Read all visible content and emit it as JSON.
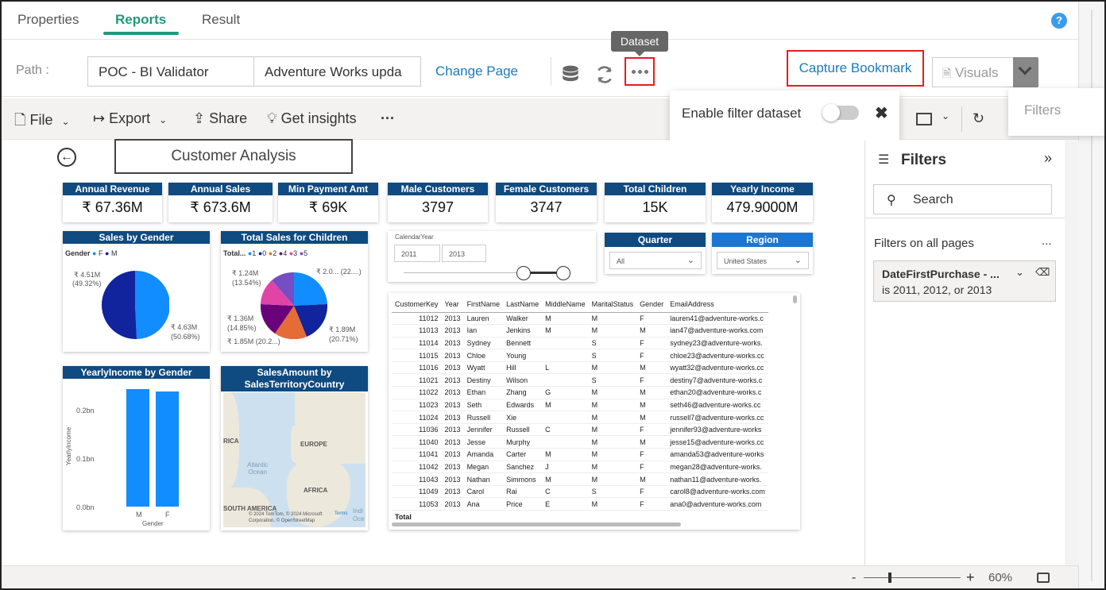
{
  "tabs": [
    {
      "label": "Properties"
    },
    {
      "label": "Reports"
    },
    {
      "label": "Result"
    }
  ],
  "help_label": "?",
  "path": {
    "label": "Path :",
    "workspace": "POC - BI Validator",
    "report": "Adventure Works upda",
    "change_page": "Change Page",
    "tooltip": "Dataset",
    "capture_bookmark": "Capture Bookmark",
    "visuals": "Visuals",
    "filters_tab": "Filters"
  },
  "toolbar": {
    "file": "File",
    "export": "Export",
    "share": "Share",
    "insights": "Get insights",
    "more": "···"
  },
  "popup": {
    "label": "Enable filter dataset",
    "close": "✖",
    "enabled": false
  },
  "report": {
    "title": "Customer Analysis",
    "cards": [
      {
        "title": "Annual Revenue",
        "value": "₹ 67.36M"
      },
      {
        "title": "Annual Sales",
        "value": "₹ 673.6M"
      },
      {
        "title": "Min Payment Amt",
        "value": "₹ 69K"
      },
      {
        "title": "Male Customers",
        "value": "3797"
      },
      {
        "title": "Female Customers",
        "value": "3747"
      },
      {
        "title": "Total Children",
        "value": "15K"
      },
      {
        "title": "Yearly Income",
        "value": "479.9000M"
      }
    ],
    "sales_by_gender": {
      "title": "Sales by Gender",
      "legend_title": "Gender",
      "legend": [
        "F",
        "M"
      ],
      "label_m": "₹ 4.51M",
      "label_m_pct": "(49.32%)",
      "label_f": "₹ 4.63M",
      "label_f_pct": "(50.68%)"
    },
    "sales_children": {
      "title": "Total Sales for Children",
      "legend_title": "Total...",
      "legend": [
        "1",
        "0",
        "2",
        "4",
        "3",
        "5"
      ],
      "lbl1": "₹ 1.24M",
      "lbl1p": "(13.54%)",
      "lbl2": "₹ 2.0... (22....)",
      "lbl3": "₹ 1.36M",
      "lbl3p": "(14.85%)",
      "lbl4": "₹ 1.89M",
      "lbl4p": "(20.71%)",
      "lbl5": "₹ 1.85M (20.2...)"
    },
    "calendar": {
      "title": "CalendarYear",
      "from": "2011",
      "to": "2013"
    },
    "quarter": {
      "title": "Quarter",
      "value": "All"
    },
    "region": {
      "title": "Region",
      "value": "United States"
    },
    "yearly_income": {
      "title": "YearlyIncome by Gender",
      "ylabel": "YearlyIncome",
      "xlabel": "Gender",
      "ticks": [
        "0.2bn",
        "0.1bn",
        "0.0bn"
      ]
    },
    "map": {
      "title": "SalesAmount by SalesTerritoryCountry",
      "labels": {
        "rica": "RICA",
        "europe": "EUROPE",
        "ocean": "Atlantic\nOcean",
        "africa": "AFRICA",
        "sa": "SOUTH AMERICA",
        "indi": "Indi",
        "oce": "Oce"
      },
      "credit": "© 2024 TomTom, © 2024 Microsoft Corporation, © OpenStreetMap",
      "terms": "Terms"
    },
    "table": {
      "headers": [
        "CustomerKey",
        "Year",
        "FirstName",
        "LastName",
        "MiddleName",
        "MaritalStatus",
        "Gender",
        "EmailAddress"
      ],
      "rows": [
        [
          "11012",
          "2013",
          "Lauren",
          "Walker",
          "M",
          "M",
          "F",
          "lauren41@adventure-works.c"
        ],
        [
          "11013",
          "2013",
          "Ian",
          "Jenkins",
          "M",
          "M",
          "M",
          "ian47@adventure-works.com"
        ],
        [
          "11014",
          "2013",
          "Sydney",
          "Bennett",
          "",
          "S",
          "F",
          "sydney23@adventure-works."
        ],
        [
          "11015",
          "2013",
          "Chloe",
          "Young",
          "",
          "S",
          "F",
          "chloe23@adventure-works.cc"
        ],
        [
          "11016",
          "2013",
          "Wyatt",
          "Hill",
          "L",
          "M",
          "M",
          "wyatt32@adventure-works.cc"
        ],
        [
          "11021",
          "2013",
          "Destiny",
          "Wilson",
          "",
          "S",
          "F",
          "destiny7@adventure-works.c"
        ],
        [
          "11022",
          "2013",
          "Ethan",
          "Zhang",
          "G",
          "M",
          "M",
          "ethan20@adventure-works.c"
        ],
        [
          "11023",
          "2013",
          "Seth",
          "Edwards",
          "M",
          "M",
          "M",
          "seth46@adventure-works.cc"
        ],
        [
          "11024",
          "2013",
          "Russell",
          "Xie",
          "",
          "M",
          "M",
          "russell7@adventure-works.cc"
        ],
        [
          "11036",
          "2013",
          "Jennifer",
          "Russell",
          "C",
          "M",
          "F",
          "jennifer93@adventure-works"
        ],
        [
          "11040",
          "2013",
          "Jesse",
          "Murphy",
          "",
          "M",
          "M",
          "jesse15@adventure-works.cc"
        ],
        [
          "11041",
          "2013",
          "Amanda",
          "Carter",
          "M",
          "M",
          "F",
          "amanda53@adventure-works"
        ],
        [
          "11042",
          "2013",
          "Megan",
          "Sanchez",
          "J",
          "M",
          "F",
          "megan28@adventure-works."
        ],
        [
          "11043",
          "2013",
          "Nathan",
          "Simmons",
          "M",
          "M",
          "M",
          "nathan11@adventure-works."
        ],
        [
          "11049",
          "2013",
          "Carol",
          "Rai",
          "C",
          "S",
          "F",
          "carol8@adventure-works.com"
        ],
        [
          "11053",
          "2013",
          "Ana",
          "Price",
          "E",
          "M",
          "F",
          "ana0@adventure-works.com"
        ]
      ],
      "total": "Total"
    }
  },
  "filters": {
    "title": "Filters",
    "collapse": "»",
    "search": "Search",
    "section": "Filters on all pages",
    "more": "...",
    "card_title": "DateFirstPurchase - ...",
    "card_value": "is 2011, 2012, or 2013"
  },
  "zoom": {
    "minus": "-",
    "plus": "+",
    "value": "60%"
  },
  "colors": {
    "accent": "#1e9a7a",
    "link": "#1a7bbd",
    "header": "#0f4a80",
    "highlight": "#e02020"
  }
}
